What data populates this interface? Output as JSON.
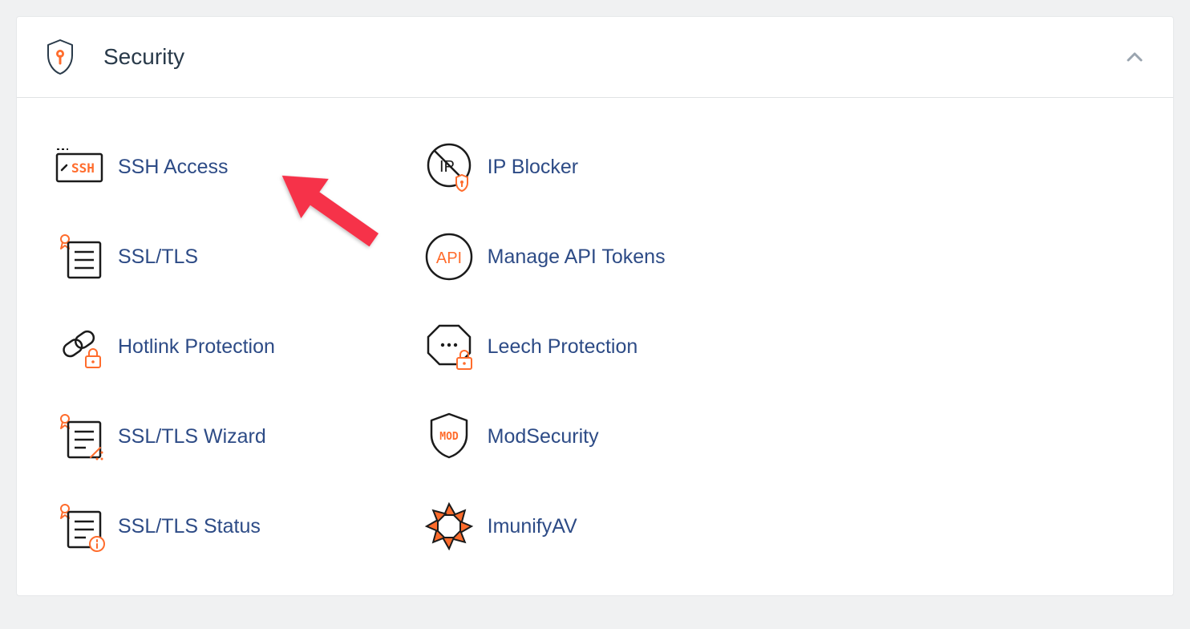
{
  "panel": {
    "title": "Security"
  },
  "items": {
    "ssh_access": "SSH Access",
    "ssl_tls": "SSL/TLS",
    "hotlink_protection": "Hotlink Protection",
    "ssl_tls_wizard": "SSL/TLS Wizard",
    "ssl_tls_status": "SSL/TLS Status",
    "ip_blocker": "IP Blocker",
    "manage_api_tokens": "Manage API Tokens",
    "leech_protection": "Leech Protection",
    "modsecurity": "ModSecurity",
    "imunifyav": "ImunifyAV"
  }
}
